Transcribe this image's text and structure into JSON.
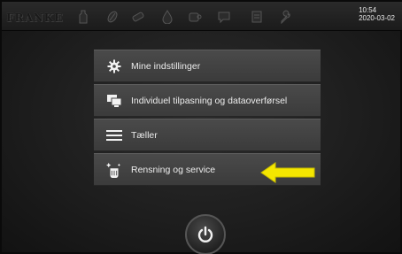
{
  "header": {
    "logo_text": "FRANKE",
    "time": "10:54",
    "date": "2020-03-02",
    "icons": [
      "bottle-icon",
      "bean-icon",
      "milk-icon",
      "drop-icon",
      "coffee-icon",
      "chat-icon",
      "document-icon",
      "wrench-icon"
    ]
  },
  "menu": {
    "items": [
      {
        "label": "Mine indstillinger",
        "icon": "gear-icon"
      },
      {
        "label": "Individuel tilpasning og dataoverførsel",
        "icon": "screens-icon"
      },
      {
        "label": "Tæller",
        "icon": "list-icon"
      },
      {
        "label": "Rensning og service",
        "icon": "cleaning-icon"
      }
    ]
  },
  "annotation": {
    "color": "#f4e600",
    "points_to": "Rensning og service"
  },
  "power_button": {
    "icon": "power-icon"
  }
}
